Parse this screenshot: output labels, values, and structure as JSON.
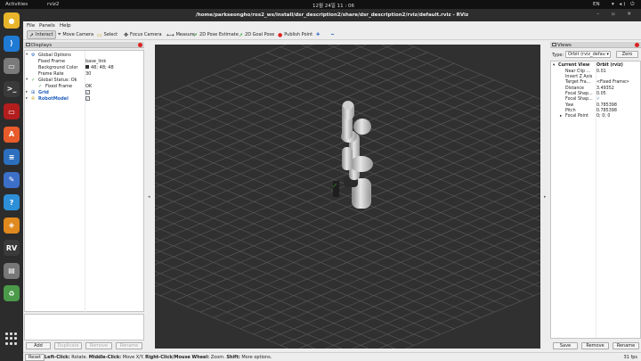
{
  "topbar": {
    "activities": "Activities",
    "app_name": "rviz2",
    "clock": "12월 24일  11 : 06",
    "lang": "EN",
    "system_icons": "▾ ◂) ⏻"
  },
  "window": {
    "title": "/home/parkseongho/ros2_ws/install/dsr_description2/share/dsr_description2/rviz/default.rviz - RViz",
    "controls": "–  ▫  ✕"
  },
  "dock": {
    "icons": [
      {
        "name": "chrome",
        "glyph": "●",
        "color": "#e8b52a"
      },
      {
        "name": "vscode",
        "glyph": "⟩",
        "color": "#1f7ad4"
      },
      {
        "name": "files",
        "glyph": "▭",
        "color": "#7a7a7a"
      },
      {
        "name": "terminal",
        "glyph": ">_",
        "color": "#3a3a3a"
      },
      {
        "name": "terminal-red",
        "glyph": "▭",
        "color": "#b31d1d"
      },
      {
        "name": "software-center",
        "glyph": "A",
        "color": "#e85b2a"
      },
      {
        "name": "text-editor",
        "glyph": "≡",
        "color": "#2c6fbe"
      },
      {
        "name": "notes",
        "glyph": "✎",
        "color": "#3c6fc8"
      },
      {
        "name": "help",
        "glyph": "?",
        "color": "#2d8fd8"
      },
      {
        "name": "layers",
        "glyph": "◈",
        "color": "#e0891e"
      },
      {
        "name": "rviz",
        "glyph": "RV",
        "color": "#3a3a3a"
      },
      {
        "name": "drive",
        "glyph": "▤",
        "color": "#777777"
      },
      {
        "name": "trash",
        "glyph": "♻",
        "color": "#4a9a4a"
      }
    ]
  },
  "menu": {
    "file": "File",
    "panels": "Panels",
    "help": "Help"
  },
  "toolbar": {
    "interact": "Interact",
    "move_camera": "Move Camera",
    "select": "Select",
    "focus_camera": "Focus Camera",
    "measure": "Measure",
    "pose_estimate": "2D Pose Estimate",
    "goal_pose": "2D Goal Pose",
    "publish_point": "Publish Point"
  },
  "displays": {
    "title": "Displays",
    "global_options": "Global Options",
    "fixed_frame_label": "Fixed Frame",
    "fixed_frame_value": "base_link",
    "bg_color_label": "Background Color",
    "bg_color_value": "48; 48; 48",
    "frame_rate_label": "Frame Rate",
    "frame_rate_value": "30",
    "global_status": "Global Status: Ok",
    "status_fixed_frame_label": "Fixed Frame",
    "status_fixed_frame_value": "OK",
    "grid": "Grid",
    "robot_model": "RobotModel",
    "add": "Add",
    "duplicate": "Duplicate",
    "remove": "Remove",
    "rename": "Rename"
  },
  "views": {
    "title": "Views",
    "type_label": "Type:",
    "type_value": "Orbit (rviz_defau ▾",
    "zero": "Zero",
    "current_view": "Current View",
    "current_view_value": "Orbit (rviz)",
    "rows": [
      {
        "k": "Near Clip ...",
        "v": "0.01"
      },
      {
        "k": "Invert Z Axis",
        "v": ""
      },
      {
        "k": "Target Fra...",
        "v": "<Fixed Frame>"
      },
      {
        "k": "Distance",
        "v": "3.49352"
      },
      {
        "k": "Focal Shap...",
        "v": "0.05"
      },
      {
        "k": "Focal Shap...",
        "v": "✓"
      },
      {
        "k": "Yaw",
        "v": "0.785398"
      },
      {
        "k": "Pitch",
        "v": "0.785398"
      }
    ],
    "focal_point": "Focal Point",
    "focal_point_value": "0; 0; 0",
    "save": "Save",
    "remove": "Remove",
    "rename": "Rename"
  },
  "status": {
    "reset": "Reset",
    "hint_left": "Left-Click:",
    "hint_left_t": " Rotate. ",
    "hint_mid": "Middle-Click:",
    "hint_mid_t": " Move X/Y. ",
    "hint_right": "Right-Click/Mouse Wheel:",
    "hint_right_t": " Zoom. ",
    "hint_shift": "Shift:",
    "hint_shift_t": " More options.",
    "fps": "31 fps"
  }
}
